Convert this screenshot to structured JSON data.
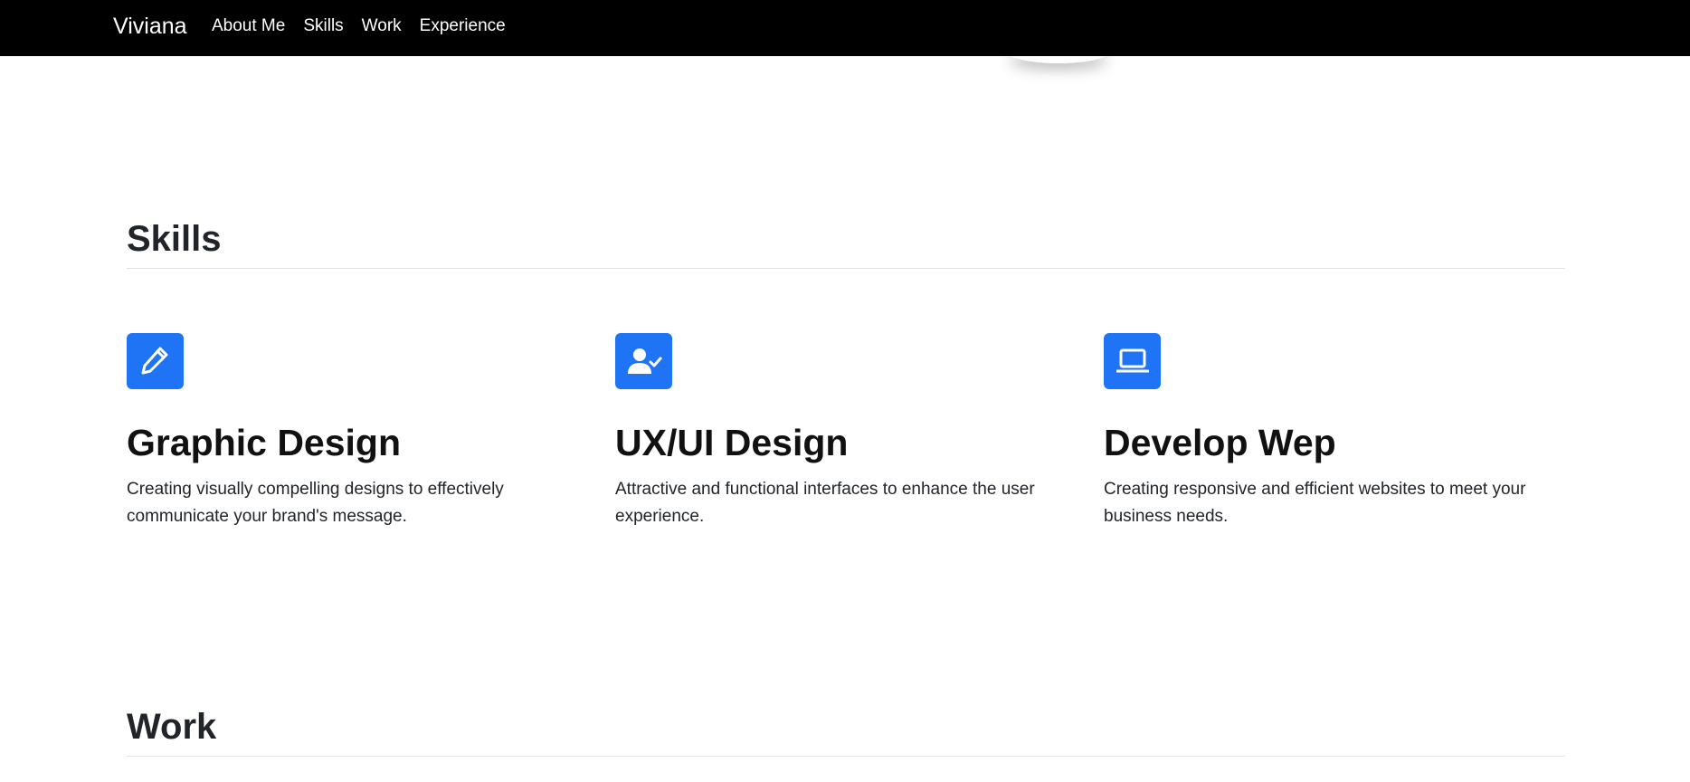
{
  "navbar": {
    "brand": "Viviana",
    "links": [
      "About Me",
      "Skills",
      "Work",
      "Experience"
    ]
  },
  "skills_section": {
    "title": "Skills",
    "items": [
      {
        "icon": "pencil-icon",
        "title": "Graphic Design",
        "description": "Creating visually compelling designs to effectively communicate your brand's message."
      },
      {
        "icon": "user-check-icon",
        "title": "UX/UI Design",
        "description": "Attractive and functional interfaces to enhance the user experience."
      },
      {
        "icon": "laptop-icon",
        "title": "Develop Wep",
        "description": "Creating responsive and efficient websites to meet your business needs."
      }
    ]
  },
  "work_section": {
    "title": "Work"
  },
  "colors": {
    "navbar_bg": "#000000",
    "accent": "#1f74f5",
    "text": "#212529",
    "divider": "#dee2e6"
  }
}
